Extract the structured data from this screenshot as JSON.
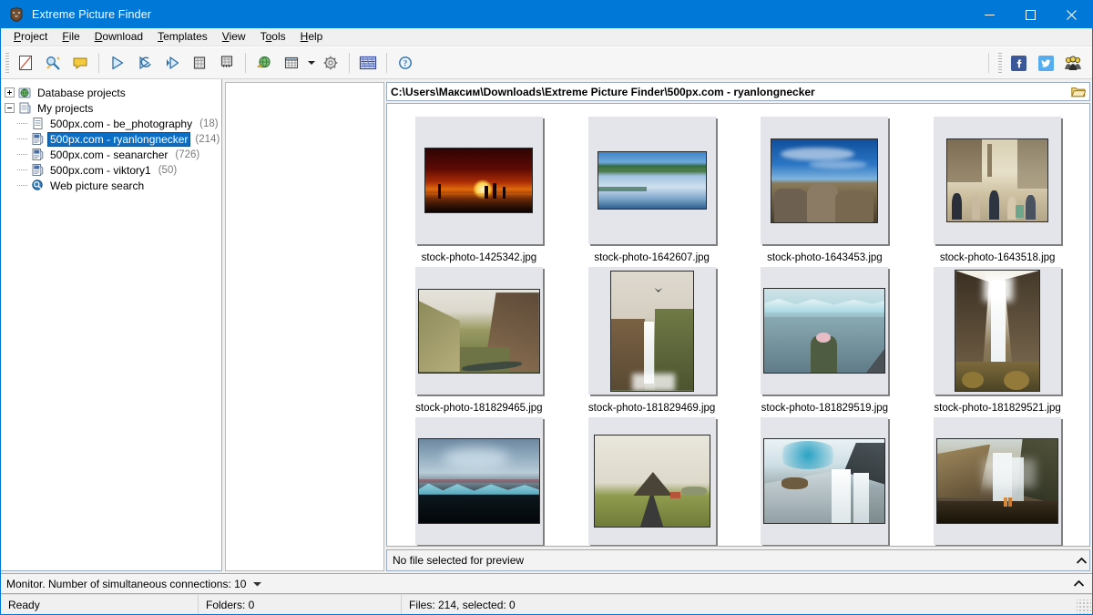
{
  "window": {
    "title": "Extreme Picture Finder",
    "app_icon": "bear-logo-icon",
    "minimize_label": "–",
    "maximize_label": "□",
    "close_label": "✕"
  },
  "menubar": {
    "items": [
      {
        "label": "Project",
        "accel": "P",
        "name": "menu-project"
      },
      {
        "label": "File",
        "accel": "F",
        "name": "menu-file"
      },
      {
        "label": "Download",
        "accel": "D",
        "name": "menu-download"
      },
      {
        "label": "Templates",
        "accel": "T",
        "name": "menu-templates"
      },
      {
        "label": "View",
        "accel": "V",
        "name": "menu-view"
      },
      {
        "label": "Tools",
        "accel": "o",
        "name": "menu-tools"
      },
      {
        "label": "Help",
        "accel": "H",
        "name": "menu-help"
      }
    ]
  },
  "toolbar": {
    "buttons": [
      {
        "name": "new-project-icon",
        "title": "New project"
      },
      {
        "name": "project-wizard-icon",
        "title": "Project wizard"
      },
      {
        "name": "comment-icon",
        "title": "Comments"
      },
      {
        "name": "start-download-icon",
        "title": "Start download"
      },
      {
        "name": "resume-download-icon",
        "title": "Resume download"
      },
      {
        "name": "step-download-icon",
        "title": "Step download"
      },
      {
        "name": "stop-download-icon",
        "title": "Stop download"
      },
      {
        "name": "stop-all-icon",
        "title": "Stop all downloads"
      },
      {
        "name": "browse-web-icon",
        "title": "Browse web"
      },
      {
        "name": "view-mode-icon",
        "title": "View mode"
      },
      {
        "name": "view-mode-dropdown-icon",
        "title": "View mode options"
      },
      {
        "name": "settings-gear-icon",
        "title": "Options"
      },
      {
        "name": "scheduler-icon",
        "title": "Scheduler"
      },
      {
        "name": "help-about-icon",
        "title": "Help"
      }
    ],
    "social": [
      {
        "name": "facebook-icon",
        "title": "Facebook",
        "color": "#3b5998",
        "glyph": "f"
      },
      {
        "name": "twitter-icon",
        "title": "Twitter",
        "color": "#55acee",
        "glyph": "t"
      },
      {
        "name": "friends-icon",
        "title": "Tell a friend"
      }
    ]
  },
  "sidebar": {
    "items": [
      {
        "label": "Database projects",
        "count": "",
        "level": 0,
        "expander": "plus",
        "icon": "globe-folder-icon",
        "selected": false,
        "name": "tree-item-database-projects"
      },
      {
        "label": "My projects",
        "count": "",
        "level": 0,
        "expander": "minus",
        "icon": "projects-icon",
        "selected": false,
        "name": "tree-item-my-projects"
      },
      {
        "label": "500px.com - be_photography",
        "count": "(18)",
        "level": 1,
        "expander": "none",
        "icon": "project-icon",
        "selected": false,
        "name": "tree-item-be-photography"
      },
      {
        "label": "500px.com - ryanlongnecker",
        "count": "(214)",
        "level": 1,
        "expander": "none",
        "icon": "project-images-icon",
        "selected": true,
        "name": "tree-item-ryanlongnecker"
      },
      {
        "label": "500px.com - seanarcher",
        "count": "(726)",
        "level": 1,
        "expander": "none",
        "icon": "project-images-icon",
        "selected": false,
        "name": "tree-item-seanarcher"
      },
      {
        "label": "500px.com - viktory1",
        "count": "(50)",
        "level": 1,
        "expander": "none",
        "icon": "project-images-icon",
        "selected": false,
        "name": "tree-item-viktory1"
      },
      {
        "label": "Web picture search",
        "count": "",
        "level": 0,
        "expander": "none",
        "icon": "search-globe-icon",
        "selected": false,
        "name": "tree-item-web-picture-search"
      }
    ]
  },
  "pathbar": {
    "path": "C:\\Users\\Максим\\Downloads\\Extreme Picture Finder\\500px.com - ryanlongnecker",
    "folder_icon": "open-folder-icon"
  },
  "thumbnails": [
    {
      "filename": "stock-photo-1425342.jpg",
      "style": "sunset",
      "orient": "landscape",
      "name": "thumbnail-stock-photo-1425342"
    },
    {
      "filename": "stock-photo-1642607.jpg",
      "style": "lake",
      "orient": "landscape",
      "name": "thumbnail-stock-photo-1642607"
    },
    {
      "filename": "stock-photo-1643453.jpg",
      "style": "rocks",
      "orient": "landscape",
      "name": "thumbnail-stock-photo-1643453"
    },
    {
      "filename": "stock-photo-1643518.jpg",
      "style": "street",
      "orient": "landscape",
      "name": "thumbnail-stock-photo-1643518"
    },
    {
      "filename": "stock-photo-181829465.jpg",
      "style": "canyon",
      "orient": "landscape",
      "name": "thumbnail-stock-photo-181829465"
    },
    {
      "filename": "stock-photo-181829469.jpg",
      "style": "fallsbird",
      "orient": "portrait",
      "name": "thumbnail-stock-photo-181829469"
    },
    {
      "filename": "stock-photo-181829519.jpg",
      "style": "glacier",
      "orient": "landscape",
      "name": "thumbnail-stock-photo-181829519"
    },
    {
      "filename": "stock-photo-181829521.jpg",
      "style": "canyonfall",
      "orient": "portrait",
      "name": "thumbnail-stock-photo-181829521"
    },
    {
      "filename": "",
      "style": "icelagoon",
      "orient": "landscape",
      "name": "thumbnail-row3-1"
    },
    {
      "filename": "",
      "style": "road",
      "orient": "landscape",
      "name": "thumbnail-row3-2"
    },
    {
      "filename": "",
      "style": "bluefalls",
      "orient": "landscape",
      "name": "thumbnail-row3-3"
    },
    {
      "filename": "",
      "style": "goldenfalls",
      "orient": "landscape",
      "name": "thumbnail-row3-4"
    }
  ],
  "preview": {
    "message": "No file selected for preview"
  },
  "monitor": {
    "text": "Monitor. Number of simultaneous connections: 10",
    "dropdown_icon": "caret-down-icon"
  },
  "statusbar": {
    "ready": "Ready",
    "folders": "Folders: 0",
    "files": "Files: 214, selected: 0"
  },
  "colors": {
    "titlebar": "#0078d7",
    "selection": "#0b6ec6",
    "panel_border": "#9badc0",
    "thumb_bg": "#e3e5ea"
  }
}
